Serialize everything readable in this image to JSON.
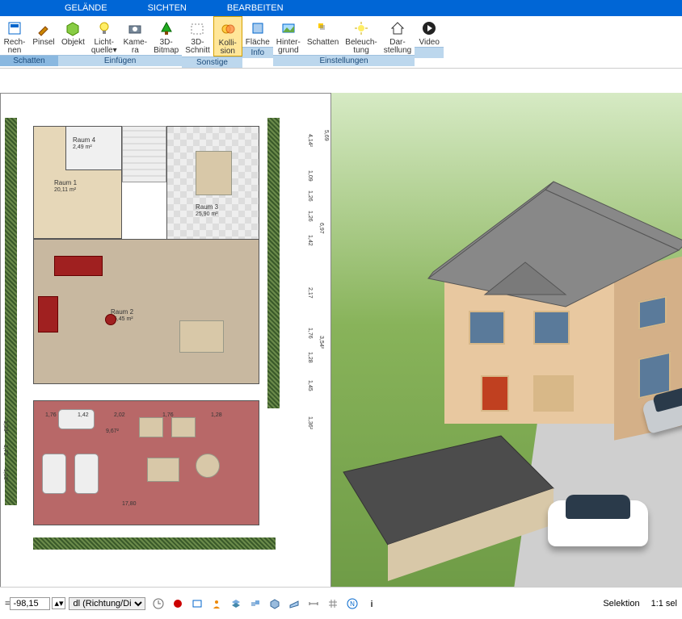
{
  "menu": {
    "gelaende": "GELÄNDE",
    "sichten": "SICHTEN",
    "bearbeiten": "BEARBEITEN"
  },
  "ribbon": {
    "groups": [
      {
        "label": "Schatten",
        "buttons": [
          {
            "name": "rechnen",
            "label": "Rech-\nnen"
          },
          {
            "name": "pinsel",
            "label": "Pinsel"
          }
        ]
      },
      {
        "label": "Einfügen",
        "buttons": [
          {
            "name": "objekt",
            "label": "Objekt"
          },
          {
            "name": "lichtquelle",
            "label": "Licht-\nquelle▾"
          },
          {
            "name": "kamera",
            "label": "Kame-\nra"
          },
          {
            "name": "bitmap3d",
            "label": "3D-\nBitmap"
          }
        ]
      },
      {
        "label": "Sonstige",
        "buttons": [
          {
            "name": "schnitt3d",
            "label": "3D-\nSchnitt"
          },
          {
            "name": "kollision",
            "label": "Kolli-\nsion",
            "active": true
          }
        ]
      },
      {
        "label": "Info",
        "buttons": [
          {
            "name": "flaeche",
            "label": "Fläche"
          }
        ]
      },
      {
        "label": "Einstellungen",
        "buttons": [
          {
            "name": "hintergrund",
            "label": "Hinter-\ngrund"
          },
          {
            "name": "schatten",
            "label": "Schatten"
          },
          {
            "name": "beleuchtung",
            "label": "Beleuch-\ntung"
          },
          {
            "name": "darstellung",
            "label": "Dar-\nstellung"
          }
        ]
      },
      {
        "label": "",
        "buttons": [
          {
            "name": "video",
            "label": "Video"
          }
        ]
      }
    ]
  },
  "rooms": {
    "r1": {
      "name": "Raum 1",
      "area": "20,11 m²"
    },
    "r2": {
      "name": "Raum 2",
      "area": "46,45 m²"
    },
    "r3": {
      "name": "Raum 3",
      "area": "25,90 m²"
    },
    "r4": {
      "name": "Raum 4",
      "area": "2,49 m²"
    }
  },
  "dimensions": {
    "right_outer": "5,69",
    "right_a": "4,14²",
    "right_b": "1,09",
    "right_c": "1,26",
    "right_d": "1,26",
    "right_e": "1,42",
    "right_f": "6,97",
    "right_g": "2,17",
    "right_h": "1,76",
    "right_i": "1,28",
    "right_j": "3,54²",
    "right_k": "1,45",
    "right_l": "1,36²",
    "left_a": "1,23²",
    "left_b": "1,72",
    "left_c": "1,23²",
    "bot_a": "1,76",
    "bot_b": "1,42",
    "bot_c": "2,02",
    "bot_d": "1,76",
    "bot_e": "1,28",
    "bot_f": "9,67²",
    "bot_g": "17,80"
  },
  "status": {
    "eq": "=",
    "value": "-98,15",
    "dropdown": "dl (Richtung/Di",
    "selektion": "Selektion",
    "scale": "1:1 sel"
  }
}
